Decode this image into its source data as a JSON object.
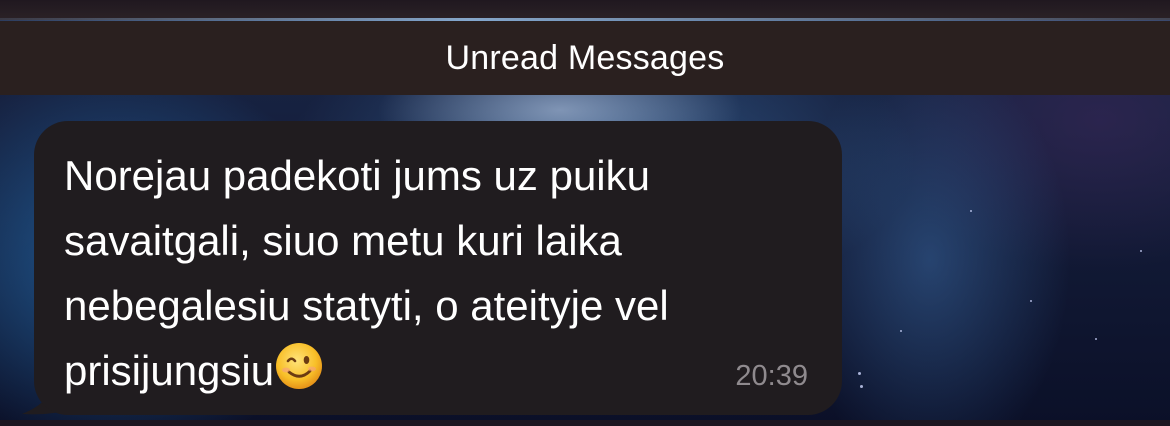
{
  "unread_divider": {
    "label": "Unread Messages"
  },
  "message": {
    "lines": [
      "Norejau padekoti jums uz puiku",
      "savaitgali, siuo metu kuri laika",
      "nebegalesiu statyti, o ateityje vel",
      "prisijungsiu"
    ],
    "emoji_icon": "winking-face-icon",
    "time": "20:39",
    "bubble_color": "#201c1f"
  },
  "colors": {
    "divider_background": "#2a201f",
    "text": "#ffffff",
    "timestamp": "#8f8a8e"
  }
}
